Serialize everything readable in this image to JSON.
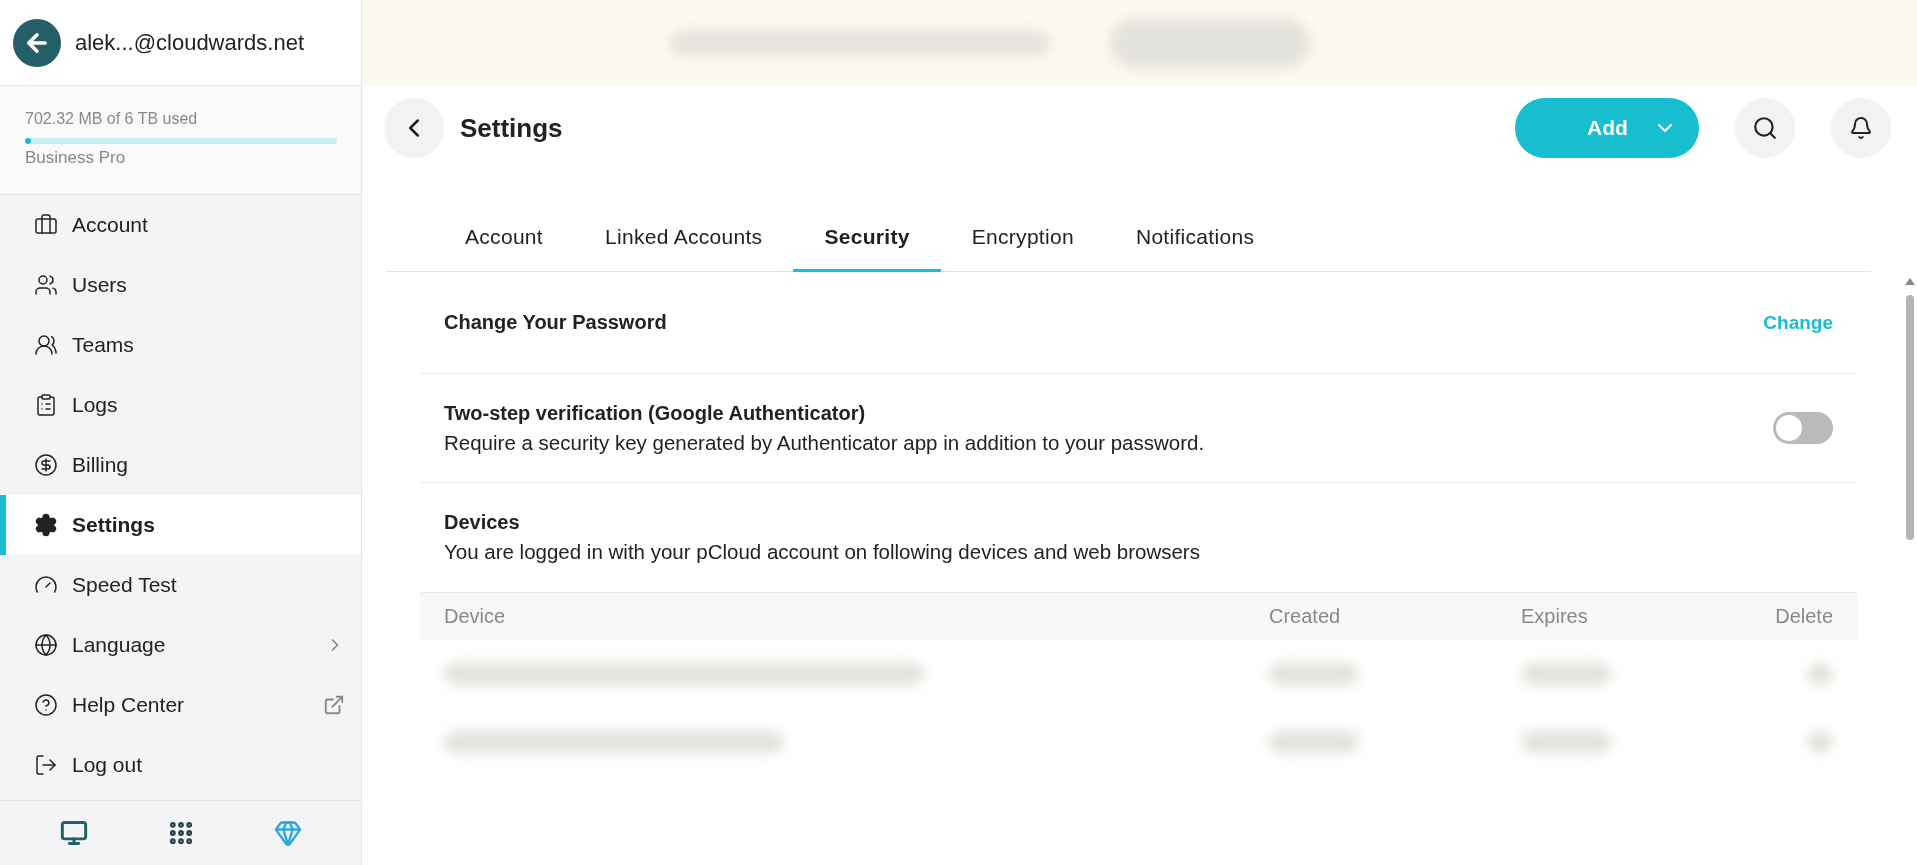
{
  "account": {
    "email": "alek...@cloudwards.net"
  },
  "storage": {
    "usage": "702.32 MB of 6 TB used",
    "level": 0.005,
    "plan": "Business Pro"
  },
  "nav": [
    {
      "label": "Account",
      "selected": false,
      "kind": "plain"
    },
    {
      "label": "Users",
      "selected": false,
      "kind": "plain"
    },
    {
      "label": "Teams",
      "selected": false,
      "kind": "plain"
    },
    {
      "label": "Logs",
      "selected": false,
      "kind": "plain"
    },
    {
      "label": "Billing",
      "selected": false,
      "kind": "plain"
    },
    {
      "label": "Settings",
      "selected": true,
      "kind": "plain"
    },
    {
      "label": "Speed Test",
      "selected": false,
      "kind": "plain"
    },
    {
      "label": "Language",
      "selected": false,
      "kind": "submenu"
    },
    {
      "label": "Help Center",
      "selected": false,
      "kind": "external"
    },
    {
      "label": "Log out",
      "selected": false,
      "kind": "plain"
    }
  ],
  "banner": {
    "redacted": true
  },
  "page": {
    "title": "Settings",
    "add_button": "Add"
  },
  "tabs": [
    {
      "label": "Account",
      "selected": false
    },
    {
      "label": "Linked Accounts",
      "selected": false
    },
    {
      "label": "Security",
      "selected": true
    },
    {
      "label": "Encryption",
      "selected": false
    },
    {
      "label": "Notifications",
      "selected": false
    }
  ],
  "password": {
    "title": "Change Your Password",
    "action": "Change"
  },
  "two_step": {
    "title": "Two-step verification (Google Authenticator)",
    "description": "Require a security key generated by Authenticator app in addition to your password.",
    "on": false
  },
  "devices": {
    "title": "Devices",
    "description": "You are logged in with your pCloud account on following devices and web browsers",
    "columns": [
      "Device",
      "Created",
      "Expires",
      "Delete"
    ],
    "rows": [
      {
        "redacted": true
      },
      {
        "redacted": true
      }
    ]
  }
}
